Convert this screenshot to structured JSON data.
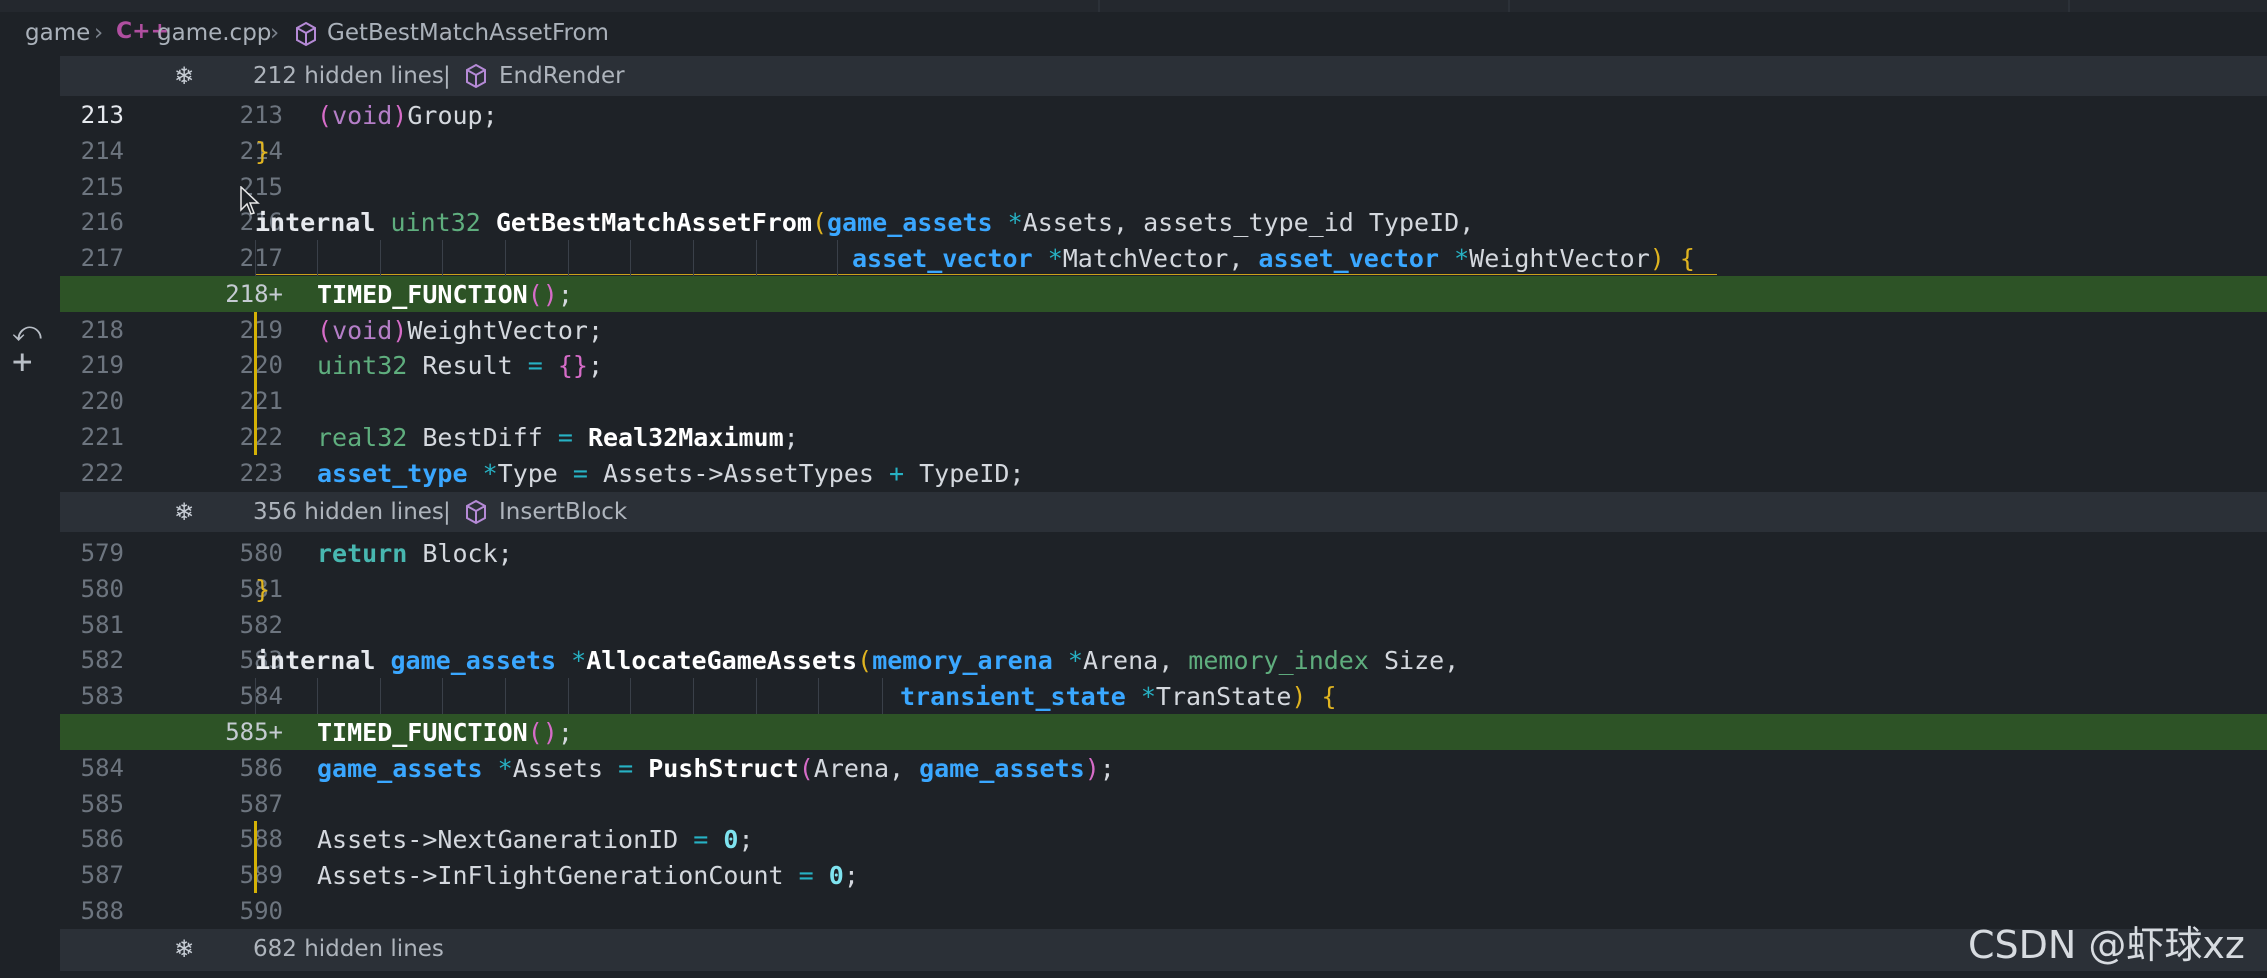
{
  "breadcrumb": {
    "items": [
      "game",
      "game.cpp",
      "GetBestMatchAssetFrom"
    ],
    "file_icon": "C++",
    "symbol_icon": "cube-icon"
  },
  "folds": [
    {
      "count": "212 hidden lines",
      "separator": "|",
      "symbol": "EndRender"
    },
    {
      "count": "356 hidden lines",
      "separator": "|",
      "symbol": "InsertBlock"
    },
    {
      "count": "682 hidden lines"
    }
  ],
  "lines": [
    {
      "old": "213",
      "new": "213"
    },
    {
      "old": "214",
      "new": "214"
    },
    {
      "old": "215",
      "new": "215"
    },
    {
      "old": "216",
      "new": "216"
    },
    {
      "old": "217",
      "new": "217"
    },
    {
      "old": "",
      "new": "218+"
    },
    {
      "old": "218",
      "new": "219"
    },
    {
      "old": "219",
      "new": "220"
    },
    {
      "old": "220",
      "new": "221"
    },
    {
      "old": "221",
      "new": "222"
    },
    {
      "old": "222",
      "new": "223"
    },
    {
      "old": "579",
      "new": "580"
    },
    {
      "old": "580",
      "new": "581"
    },
    {
      "old": "581",
      "new": "582"
    },
    {
      "old": "582",
      "new": "583"
    },
    {
      "old": "583",
      "new": "584"
    },
    {
      "old": "",
      "new": "585+"
    },
    {
      "old": "584",
      "new": "586"
    },
    {
      "old": "585",
      "new": "587"
    },
    {
      "old": "586",
      "new": "588"
    },
    {
      "old": "587",
      "new": "589"
    },
    {
      "old": "588",
      "new": "590"
    }
  ],
  "code": {
    "l213": [
      "(",
      "void",
      ")",
      "Group;"
    ],
    "l214": [
      "}"
    ],
    "l216": [
      "internal",
      " ",
      "uint32",
      " ",
      "GetBestMatchAssetFrom",
      "(",
      "game_assets",
      " ",
      "*",
      "Assets, assets_type_id TypeID,"
    ],
    "l217": [
      "asset_vector",
      " ",
      "*",
      "MatchVector, ",
      "asset_vector",
      " ",
      "*",
      "WeightVector",
      ")",
      " ",
      "{"
    ],
    "l218a": [
      "TIMED_FUNCTION",
      "()",
      ";"
    ],
    "l218": [
      "(",
      "void",
      ")",
      "WeightVector;"
    ],
    "l219": [
      "uint32",
      " Result ",
      "=",
      " ",
      "{}",
      ";"
    ],
    "l221": [
      "real32",
      " BestDiff ",
      "=",
      " ",
      "Real32Maximum",
      ";"
    ],
    "l222": [
      "asset_type",
      " ",
      "*",
      "Type ",
      "=",
      " Assets->AssetTypes ",
      "+",
      " TypeID;"
    ],
    "l579": [
      "return",
      " Block;"
    ],
    "l580": [
      "}"
    ],
    "l582": [
      "internal",
      " ",
      "game_assets",
      " ",
      "*",
      "AllocateGameAssets",
      "(",
      "memory_arena",
      " ",
      "*",
      "Arena, ",
      "memory_index",
      " Size,"
    ],
    "l583": [
      "transient_state",
      " ",
      "*",
      "TranState",
      ")",
      " ",
      "{"
    ],
    "l585a": [
      "TIMED_FUNCTION",
      "()",
      ";"
    ],
    "l584": [
      "game_assets",
      " ",
      "*",
      "Assets ",
      "=",
      " ",
      "PushStruct",
      "(",
      "Arena, ",
      "game_assets",
      ")",
      ";"
    ],
    "l586": [
      "Assets->NextGanerationID ",
      "=",
      " ",
      "0",
      ";"
    ],
    "l587": [
      "Assets->InFlightGenerationCount ",
      "=",
      " ",
      "0",
      ";"
    ]
  },
  "watermark": "CSDN @虾球xz",
  "colors": {
    "added_line": "#2d5326",
    "change_bar": "#d4b106",
    "type_blue": "#3aa7ff",
    "fold_bar": "#2b3037"
  }
}
